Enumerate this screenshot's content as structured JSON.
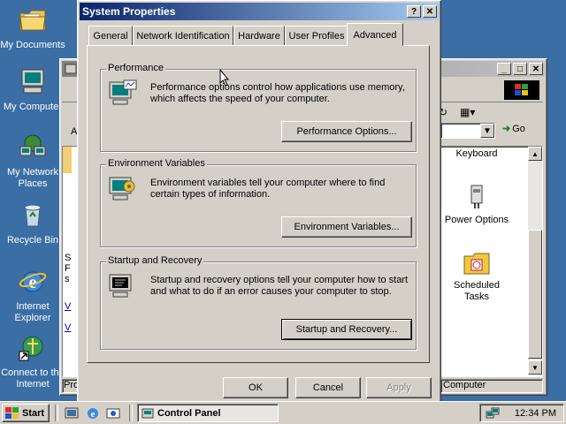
{
  "desktop": {
    "icons": [
      {
        "label": "My Documents",
        "icon": "folder-documents-icon"
      },
      {
        "label": "My Computer",
        "icon": "computer-icon"
      },
      {
        "label": "My Network Places",
        "icon": "network-places-icon"
      },
      {
        "label": "Recycle Bin",
        "icon": "recycle-bin-icon"
      },
      {
        "label": "Internet Explorer",
        "icon": "internet-explorer-icon"
      },
      {
        "label": "Connect to the Internet",
        "icon": "connect-internet-icon"
      }
    ]
  },
  "control_panel": {
    "address_go": "Go",
    "partial_left_text": "A",
    "items": [
      {
        "label": "Keyboard"
      },
      {
        "label": "Power Options"
      },
      {
        "label": "Scheduled Tasks"
      }
    ],
    "status_left": "Pro",
    "status_right": "Computer"
  },
  "dialog": {
    "title": "System Properties",
    "help_btn": "?",
    "close_btn": "✕",
    "tabs": [
      "General",
      "Network Identification",
      "Hardware",
      "User Profiles",
      "Advanced"
    ],
    "active_tab": "Advanced",
    "groups": [
      {
        "title": "Performance",
        "desc": "Performance options control how applications use memory, which affects the speed of your computer.",
        "button": "Performance Options..."
      },
      {
        "title": "Environment Variables",
        "desc": "Environment variables tell your computer where to find certain types of information.",
        "button": "Environment Variables..."
      },
      {
        "title": "Startup and Recovery",
        "desc": "Startup and recovery options tell your computer how to start and what to do if an error causes your computer to stop.",
        "button": "Startup and Recovery..."
      }
    ],
    "ok": "OK",
    "cancel": "Cancel",
    "apply": "Apply"
  },
  "taskbar": {
    "start": "Start",
    "task": "Control Panel",
    "clock": "12:34 PM"
  },
  "colors": {
    "desktop": "#3a6ea5",
    "title_active": "#0a246a",
    "title_inactive": "#808080",
    "face": "#d4d0c8"
  }
}
